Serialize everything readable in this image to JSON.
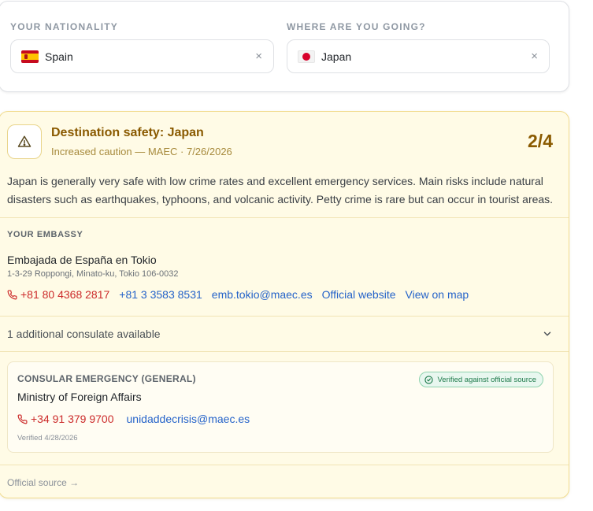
{
  "nationality": {
    "label": "YOUR NATIONALITY",
    "value": "Spain",
    "flag": "spain-flag-icon",
    "clear_icon": "×"
  },
  "destination": {
    "label": "WHERE ARE YOU GOING?",
    "value": "Japan",
    "flag": "japan-flag-icon",
    "clear_icon": "×"
  },
  "safety": {
    "title": "Destination safety: Japan",
    "subtitle": "Increased caution — MAEC · 7/26/2026",
    "level": "2/4",
    "summary": "Japan is generally very safe with low crime rates and excellent emergency services. Main risks include natural disasters such as earthquakes, typhoons, and volcanic activity. Petty crime is rare but can occur in tourist areas.",
    "colors": {
      "background": "#fffbe6",
      "accent": "#8a5a00",
      "border": "#f1dc8f"
    }
  },
  "embassy": {
    "label": "YOUR EMBASSY",
    "name": "Embajada de España en Tokio",
    "address": "1-3-29 Roppongi, Minato-ku, Tokio 106-0032",
    "phone_emergency": "+81 80 4368 2817",
    "phone": "+81 3 3583 8531",
    "email": "emb.tokio@maec.es",
    "website": "Official website",
    "map": "View on map"
  },
  "consulate": {
    "text": "1 additional consulate available"
  },
  "emergency": {
    "label": "CONSULAR EMERGENCY (GENERAL)",
    "badge": "Verified against official source",
    "name": "Ministry of Foreign Affairs",
    "phone": "+34 91 379 9700",
    "email": "unidaddecrisis@maec.es",
    "verified": "Verified 4/28/2026"
  },
  "footer": {
    "official_source": "Official source →"
  }
}
